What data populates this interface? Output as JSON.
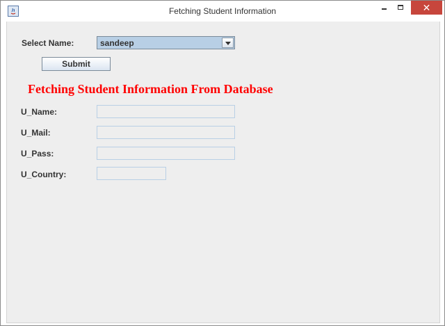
{
  "window": {
    "title": "Fetching Student Information",
    "close_glyph": "✕"
  },
  "form": {
    "select_label": "Select Name:",
    "selected_name": "sandeep",
    "submit_label": "Submit",
    "heading": "Fetching Student Information From Database",
    "fields": [
      {
        "label": "U_Name:",
        "value": ""
      },
      {
        "label": "U_Mail:",
        "value": ""
      },
      {
        "label": "U_Pass:",
        "value": ""
      },
      {
        "label": "U_Country:",
        "value": ""
      }
    ]
  },
  "colors": {
    "heading": "#ff0000",
    "close_button": "#c7463c",
    "combo_background": "#b8cfe5"
  },
  "icons": {
    "app": "java-app-icon",
    "minimize": "minimize-icon",
    "maximize": "maximize-icon",
    "close": "close-icon",
    "dropdown": "chevron-down-icon"
  }
}
